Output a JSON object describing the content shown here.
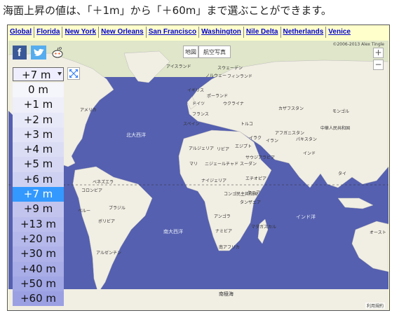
{
  "caption": "海面上昇の値は、「＋1m」から「＋60m」まで選ぶことができます。",
  "nav": [
    "Global",
    "Florida",
    "New York",
    "New Orleans",
    "San Francisco",
    "Washington",
    "Nile Delta",
    "Netherlands",
    "Venice"
  ],
  "map": {
    "type_buttons": [
      "地図",
      "航空写真"
    ],
    "zoom_in": "+",
    "zoom_out": "−",
    "copyright": "©2006-2013 Alex Tingle",
    "terms": "利用規約",
    "land_labels": [
      "アイスランド",
      "スウェーデン",
      "ノルウェー",
      "フィンランド",
      "イギリス",
      "ポーランド",
      "ドイツ",
      "ウクライナ",
      "フランス",
      "カザフスタン",
      "モンゴル",
      "スペイン",
      "トルコ",
      "中華人民共和国",
      "アメリカ",
      "アフガニスタン",
      "イラン",
      "パキスタン",
      "イラク",
      "アルジェリア",
      "リビア",
      "エジプト",
      "サウジアラビア",
      "マリ",
      "ニジェール",
      "チャド",
      "スーダン",
      "インド",
      "タイ",
      "ベネズエラ",
      "コロンビア",
      "ナイジェリア",
      "エチオピア",
      "コンゴ民主共和国",
      "ケニア",
      "タンザニア",
      "ペルー",
      "ブラジル",
      "アンゴラ",
      "ボリビア",
      "ナミビア",
      "マダガスカル",
      "アルゼンチン",
      "南アフリカ",
      "オースト"
    ],
    "ocean_labels": [
      "北大西洋",
      "南大西洋",
      "インド洋",
      "南極海"
    ]
  },
  "sea_level": {
    "selected": "+7 m",
    "options": [
      "0 m",
      "+1 m",
      "+2 m",
      "+3 m",
      "+4 m",
      "+5 m",
      "+6 m",
      "+7 m",
      "+9 m",
      "+13 m",
      "+20 m",
      "+30 m",
      "+40 m",
      "+50 m",
      "+60 m"
    ],
    "selected_index": 7
  },
  "colors": {
    "ocean": "#5560b0",
    "land": "#f1eee3",
    "water_level_selected": "#3399ff",
    "link": "#0000cc",
    "frame_bg": "#ffffcc"
  }
}
